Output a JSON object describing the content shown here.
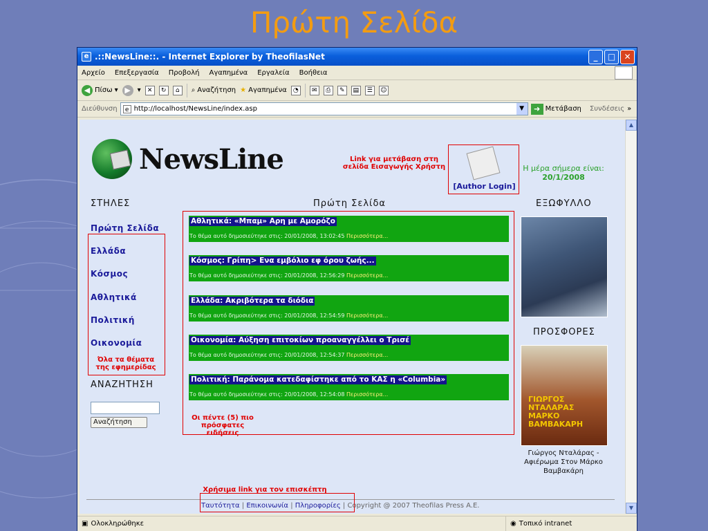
{
  "slide_title": "Πρώτη Σελίδα",
  "window": {
    "title": ".::NewsLine::. - Internet Explorer by TheofilasNet",
    "minimize": "_",
    "maximize": "□",
    "close": "✕"
  },
  "menu": [
    "Αρχείο",
    "Επεξεργασία",
    "Προβολή",
    "Αγαπημένα",
    "Εργαλεία",
    "Βοήθεια"
  ],
  "toolbar": {
    "back": "Πίσω",
    "search": "Αναζήτηση",
    "favorites": "Αγαπημένα"
  },
  "address": {
    "label": "Διεύθυνση",
    "url": "http://localhost/NewsLine/index.asp",
    "go": "Μετάβαση",
    "links": "Συνδέσεις"
  },
  "page": {
    "brand": "NewsLine",
    "author_annotation": "Link για μετάβαση στη σελίδα Εισαγωγής Χρήστη",
    "author_link": "[Author Login]",
    "today_label": "Η μέρα σήμερα είναι:",
    "today_date": "20/1/2008",
    "columns_heading": "ΣΤΗΛΕΣ",
    "center_heading": "Πρώτη Σελίδα",
    "cover_heading": "ΕΞΩΦΥΛΛΟ",
    "offers_heading": "ΠΡΟΣΦΟΡΕΣ",
    "nav": [
      "Πρώτη Σελίδα",
      "Ελλάδα",
      "Κόσμος",
      "Αθλητικά",
      "Πολιτική",
      "Οικονομία"
    ],
    "nav_annotation": "Όλα τα θέματα της εφημερίδας",
    "search_heading": "ΑΝΑΖΗΤΗΣΗ",
    "search_value": "",
    "search_button": "Αναζήτηση",
    "news": [
      {
        "headline": "Αθλητικά: «Μπαμ» Αρη με Αμορόζο",
        "meta": "Το θέμα αυτό δημοσιεύτηκε στις: 20/01/2008, 13:02:45",
        "more": "Περισσότερα..."
      },
      {
        "headline": "Κόσμος: Γρίπη> Ενα εμβόλιο εφ όρου ζωής...",
        "meta": "Το θέμα αυτό δημοσιεύτηκε στις: 20/01/2008, 12:56:29",
        "more": "Περισσότερα..."
      },
      {
        "headline": "Ελλάδα: Ακριβότερα τα διόδια",
        "meta": "Το θέμα αυτό δημοσιεύτηκε στις: 20/01/2008, 12:54:59",
        "more": "Περισσότερα..."
      },
      {
        "headline": "Οικονομία: Αύξηση επιτοκίων προαναγγέλλει ο Τρισέ",
        "meta": "Το θέμα αυτό δημοσιεύτηκε στις: 20/01/2008, 12:54:37",
        "more": "Περισσότερα..."
      },
      {
        "headline": "Πολιτική: Παράνομα κατεδαφίστηκε από το ΚΑΣ η «Columbia»",
        "meta": "Το θέμα αυτό δημοσιεύτηκε στις: 20/01/2008, 12:54:08",
        "more": "Περισσότερα..."
      }
    ],
    "news_annotation": "Οι πέντε (5) πιο πρόσφατες ειδήσεις",
    "offer_cover_text": "ΓΙΩΡΓΟΣ ΝΤΑΛΑΡΑΣ ΜΑΡΚΟ ΒΑΜΒΑΚΑΡΗ",
    "offer_caption": "Γιώργος Νταλάρας - Αφιέρωμα Στον Μάρκο Βαμβακάρη",
    "footer_annotation": "Χρήσιμα link για τον επισκέπτη",
    "footer_links": [
      "Ταυτότητα",
      "Επικοινωνία",
      "Πληροφορίες"
    ],
    "footer_sep": "|",
    "copyright": "Copyright @ 2007 Theofilas Press A.E."
  },
  "status": {
    "left": "Ολοκληρώθηκε",
    "zone": "Τοπικό intranet"
  }
}
